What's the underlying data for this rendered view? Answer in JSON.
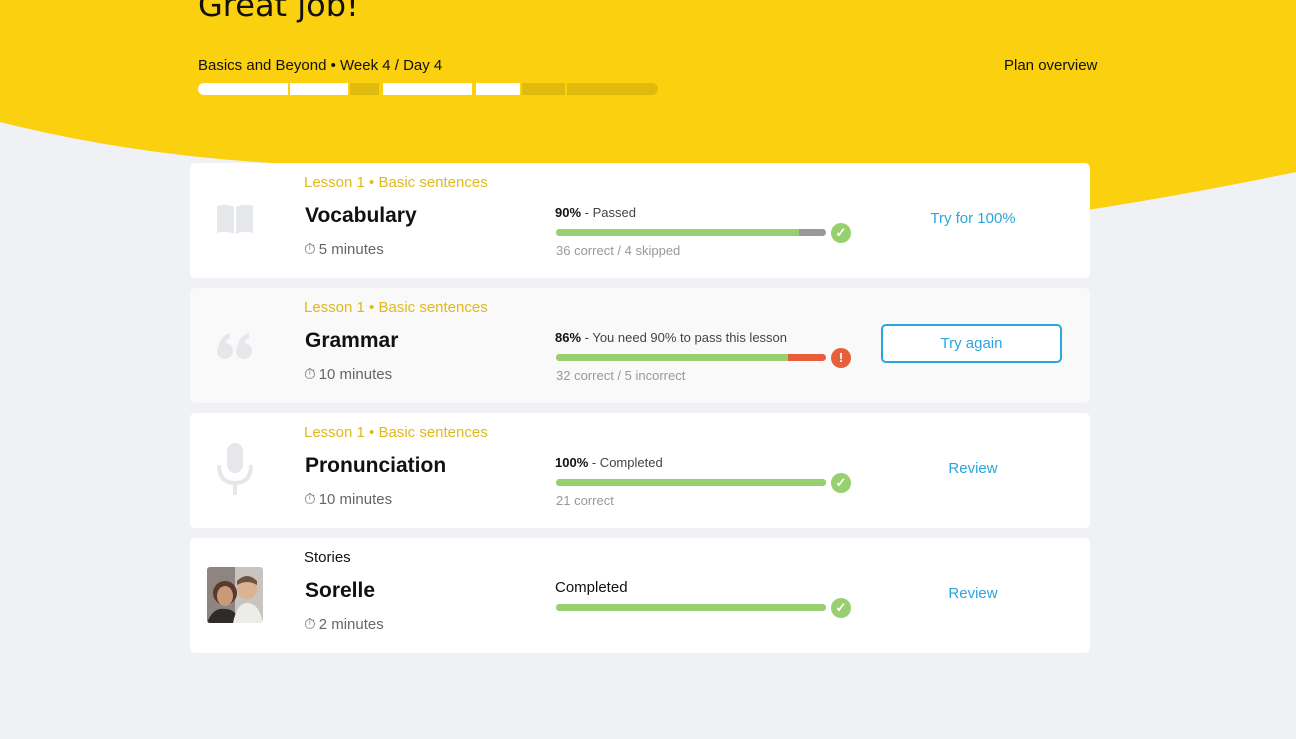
{
  "header": {
    "title": "Great job!",
    "plan_title": "Basics and Beyond • Week 4 / Day 4",
    "plan_overview_label": "Plan overview",
    "colors": {
      "accent": "#fbd00e",
      "segment_done": "#ffffff",
      "segment_todo": "#e0bb0e"
    },
    "plan_progress": {
      "segments": [
        {
          "status": "done"
        },
        {
          "status": "done"
        },
        {
          "status": "todo"
        },
        {
          "status": "done"
        },
        {
          "status": "done"
        },
        {
          "status": "todo"
        },
        {
          "status": "todo"
        }
      ]
    }
  },
  "lessons": [
    {
      "subtitle": "Lesson 1 • Basic sentences",
      "title": "Vocabulary",
      "icon": "book-icon",
      "duration": "5 minutes",
      "score_pct": "90%",
      "score_text": " - Passed",
      "progress": 0.9,
      "remainder": "skipped",
      "stat": "36 correct / 4 skipped",
      "status": "passed",
      "action": "Try for 100%",
      "action_style": "link"
    },
    {
      "subtitle": "Lesson 1 • Basic sentences",
      "title": "Grammar",
      "icon": "quote-icon",
      "duration": "10 minutes",
      "score_pct": "86%",
      "score_text": " - You need 90% to pass this lesson",
      "progress": 0.86,
      "remainder": "incorrect",
      "stat": "32 correct / 5 incorrect",
      "status": "failed",
      "action": "Try again",
      "action_style": "button"
    },
    {
      "subtitle": "Lesson 1 • Basic sentences",
      "title": "Pronunciation",
      "icon": "microphone-icon",
      "duration": "10 minutes",
      "score_pct": "100%",
      "score_text": " - Completed",
      "progress": 1.0,
      "stat": "21 correct",
      "status": "passed",
      "action": "Review",
      "action_style": "link"
    },
    {
      "subtitle": "Stories",
      "title": "Sorelle",
      "icon": "story-photo",
      "duration": "2 minutes",
      "status_label": "Completed",
      "progress": 1.0,
      "status": "passed",
      "action": "Review",
      "action_style": "link"
    }
  ]
}
